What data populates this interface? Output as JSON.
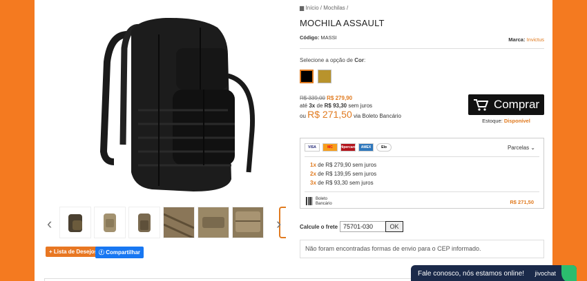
{
  "breadcrumb": {
    "home": "Início",
    "sep1": "/",
    "category": "Mochilas",
    "sep2": "/"
  },
  "product": {
    "title": "MOCHILA ASSAULT",
    "code_label": "Código:",
    "code": "MASSI",
    "brand_label": "Marca:",
    "brand": "Invictus"
  },
  "options": {
    "label": "Selecione a opção de",
    "name": "Cor",
    "colon": ":",
    "swatches": [
      {
        "name": "black",
        "color": "#000000"
      },
      {
        "name": "coyote",
        "color": "#b8932c"
      }
    ]
  },
  "price": {
    "old": "R$ 339,00",
    "current": "R$ 279,90",
    "installment_prefix": "até",
    "installment_count": "3x",
    "installment_of": "de",
    "installment_value": "R$ 93,30",
    "installment_suffix": "sem juros",
    "boleto_prefix": "ou",
    "boleto_value": "R$ 271,50",
    "boleto_suffix": "via Boleto Bancário"
  },
  "buy": {
    "label": "Comprar",
    "icon": "cart-icon"
  },
  "stock": {
    "label": "Estoque:",
    "value": "Disponível"
  },
  "payment": {
    "cards": [
      "VISA",
      "MC",
      "Hipercard",
      "AMEX",
      "Elo"
    ],
    "parcelas_label": "Parcelas",
    "installments": [
      {
        "n": "1x",
        "text": "de R$ 279,90 sem juros"
      },
      {
        "n": "2x",
        "text": "de R$ 139,95 sem juros"
      },
      {
        "n": "3x",
        "text": "de R$ 93,30 sem juros"
      }
    ],
    "boleto_label_1": "Boleto",
    "boleto_label_2": "Bancário",
    "boleto_price": "R$ 271,50"
  },
  "shipping": {
    "label": "Calcule o frete",
    "cep": "75701-030",
    "ok": "OK",
    "message": "Não foram encontradas formas de envio para o CEP informado."
  },
  "actions": {
    "wishlist": "+ Lista de Desejos",
    "share": "Compartilhar"
  },
  "chat": {
    "text": "Fale conosco, nós estamos online!",
    "brand": "jivochat"
  },
  "colors": {
    "accent": "#e07a1f",
    "background": "#f47a20"
  }
}
